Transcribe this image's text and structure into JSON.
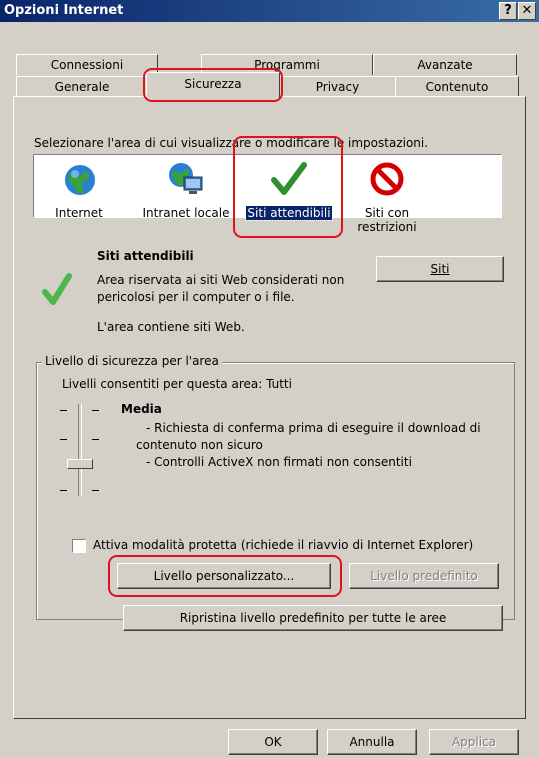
{
  "window": {
    "title": "Opzioni Internet",
    "help_btn": "?",
    "close_btn": "✕"
  },
  "tabs": {
    "row1": [
      "Connessioni",
      "Programmi",
      "Avanzate"
    ],
    "row2": [
      "Generale",
      "Sicurezza",
      "Privacy",
      "Contenuto"
    ],
    "active": "Sicurezza"
  },
  "zones": {
    "instruction": "Selezionare l'area di cui visualizzare o modificare le impostazioni.",
    "items": [
      {
        "label": "Internet",
        "icon": "globe-icon"
      },
      {
        "label": "Intranet locale",
        "icon": "intranet-icon"
      },
      {
        "label": "Siti attendibili",
        "icon": "checkmark-icon",
        "selected": true
      },
      {
        "label": "Siti con restrizioni",
        "icon": "restricted-icon"
      }
    ]
  },
  "zone_info": {
    "title": "Siti attendibili",
    "desc_line1": "Area riservata ai siti Web considerati non",
    "desc_line2": "pericolosi per il computer o i file.",
    "contains": "L'area contiene siti Web.",
    "sites_button": "Siti"
  },
  "security_level": {
    "group_label": "Livello di sicurezza per l'area",
    "allowed": "Livelli consentiti per questa area: Tutti",
    "level": "Media",
    "bullet1": "- Richiesta di conferma prima di eseguire il download di",
    "bullet1b": "contenuto non sicuro",
    "bullet2": "- Controlli ActiveX non firmati non consentiti",
    "protected_mode": "Attiva modalità protetta (richiede il riavvio di Internet Explorer)",
    "protected_checked": false,
    "custom_button": "Livello personalizzato...",
    "default_button": "Livello predefinito",
    "reset_all_button": "Ripristina livello predefinito per tutte le aree"
  },
  "footer": {
    "ok": "OK",
    "cancel": "Annulla",
    "apply": "Applica"
  },
  "colors": {
    "highlight": "#e0121c",
    "selection": "#0a246a",
    "face": "#d4d0c8"
  }
}
